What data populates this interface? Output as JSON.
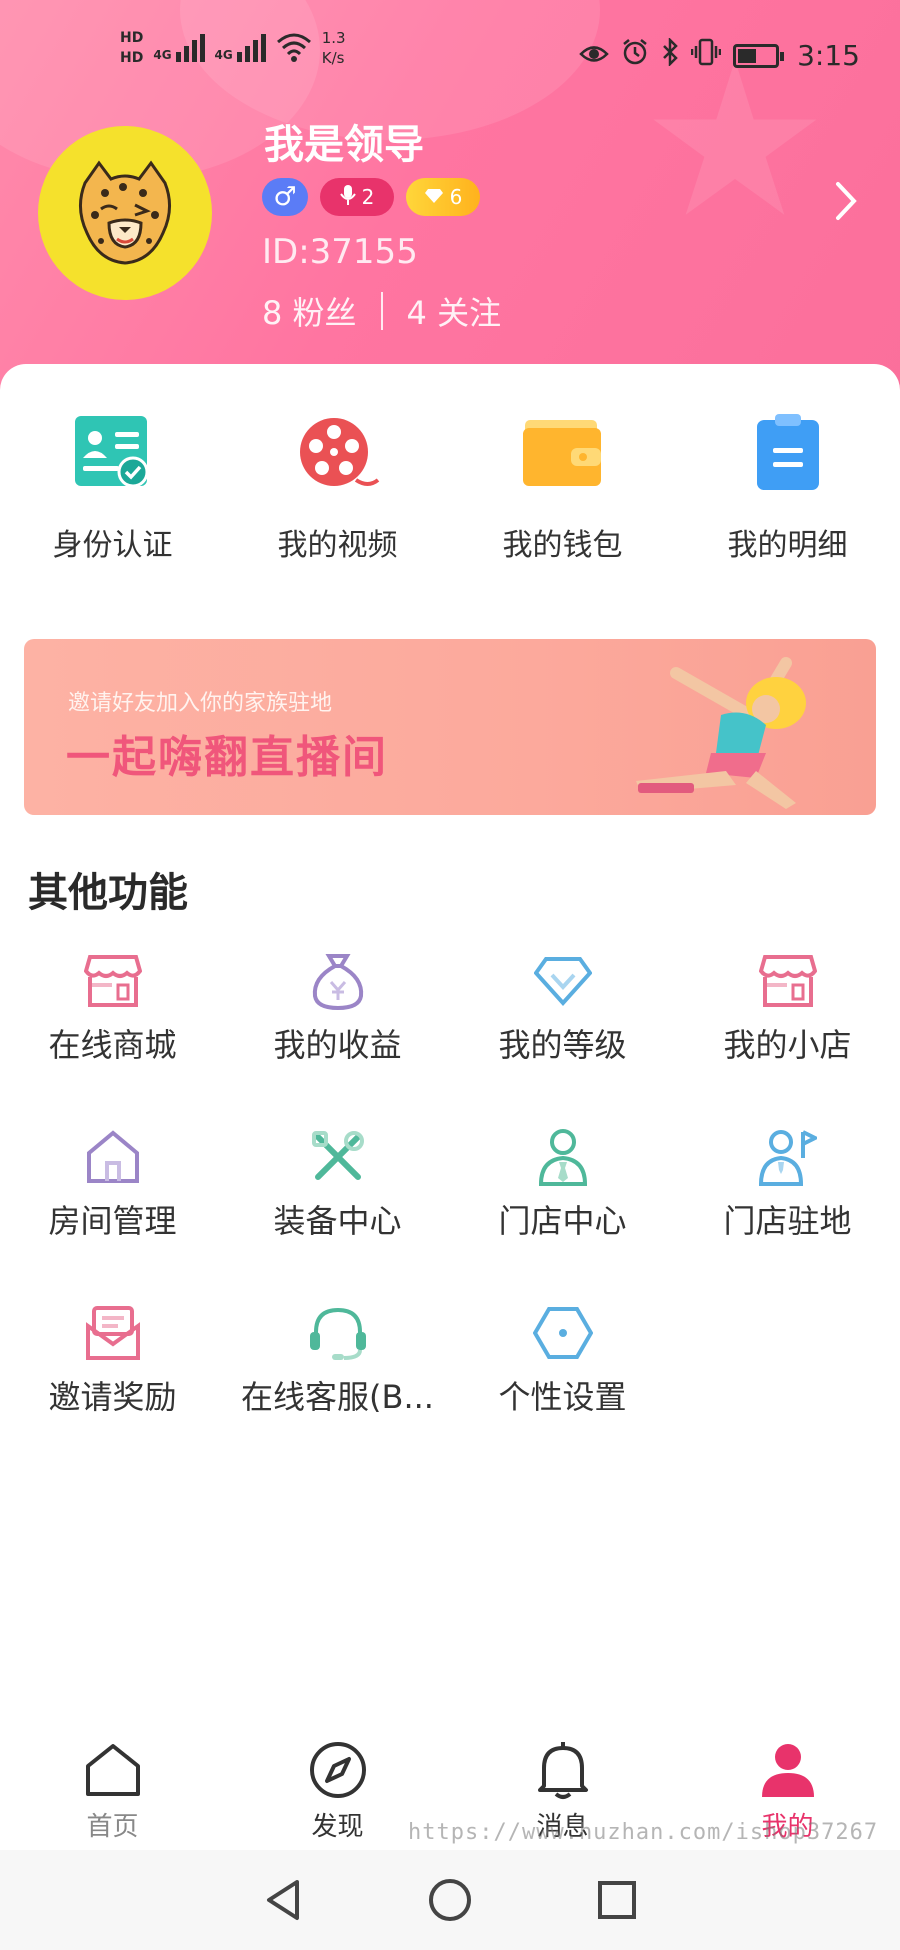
{
  "status_bar": {
    "hd1": "HD",
    "hd2": "HD",
    "net1": "4G",
    "net2": "4G",
    "speed_value": "1.3",
    "speed_unit": "K/s",
    "time": "3:15",
    "icons": [
      "eye-icon",
      "alarm-icon",
      "bluetooth-icon",
      "vibrate-icon",
      "battery-icon"
    ],
    "battery_level": 0.45
  },
  "profile": {
    "username": "我是领导",
    "gender_symbol": "♂",
    "mic_level": "2",
    "gem_level": "6",
    "user_id": "ID:37155",
    "fans": "8 粉丝",
    "following": "4 关注"
  },
  "quick_actions": [
    {
      "label": "身份认证",
      "icon": "id-card-icon"
    },
    {
      "label": "我的视频",
      "icon": "film-reel-icon"
    },
    {
      "label": "我的钱包",
      "icon": "wallet-icon"
    },
    {
      "label": "我的明细",
      "icon": "clipboard-icon"
    }
  ],
  "banner": {
    "subtitle": "邀请好友加入你的家族驻地",
    "title": "一起嗨翻直播间"
  },
  "section_title": "其他功能",
  "features": [
    {
      "label": "在线商城",
      "icon": "store-icon",
      "color": "#e86e8f"
    },
    {
      "label": "我的收益",
      "icon": "money-bag-icon",
      "color": "#9b85c7"
    },
    {
      "label": "我的等级",
      "icon": "diamond-icon",
      "color": "#5aaee0"
    },
    {
      "label": "我的小店",
      "icon": "shop-icon",
      "color": "#e86e8f"
    },
    {
      "label": "房间管理",
      "icon": "house-icon",
      "color": "#9b85c7"
    },
    {
      "label": "装备中心",
      "icon": "tools-icon",
      "color": "#4fb89a"
    },
    {
      "label": "门店中心",
      "icon": "person-tie-icon",
      "color": "#4fb89a"
    },
    {
      "label": "门店驻地",
      "icon": "person-flag-icon",
      "color": "#5aaee0"
    },
    {
      "label": "邀请奖励",
      "icon": "envelope-icon",
      "color": "#e86e8f"
    },
    {
      "label": "在线客服(B...",
      "icon": "headset-icon",
      "color": "#4fb89a"
    },
    {
      "label": "个性设置",
      "icon": "hexagon-settings-icon",
      "color": "#5aaee0"
    }
  ],
  "tabs": [
    {
      "label": "首页",
      "icon": "home-icon"
    },
    {
      "label": "发现",
      "icon": "compass-icon"
    },
    {
      "label": "消息",
      "icon": "bell-icon"
    },
    {
      "label": "我的",
      "icon": "user-icon"
    }
  ],
  "watermark": "https://www.huzhan.com/ishop37267",
  "colors": {
    "header_pink": "#ff75a1",
    "accent": "#e8336b",
    "avatar_bg": "#f5e12c",
    "banner_title": "#f0567b"
  }
}
